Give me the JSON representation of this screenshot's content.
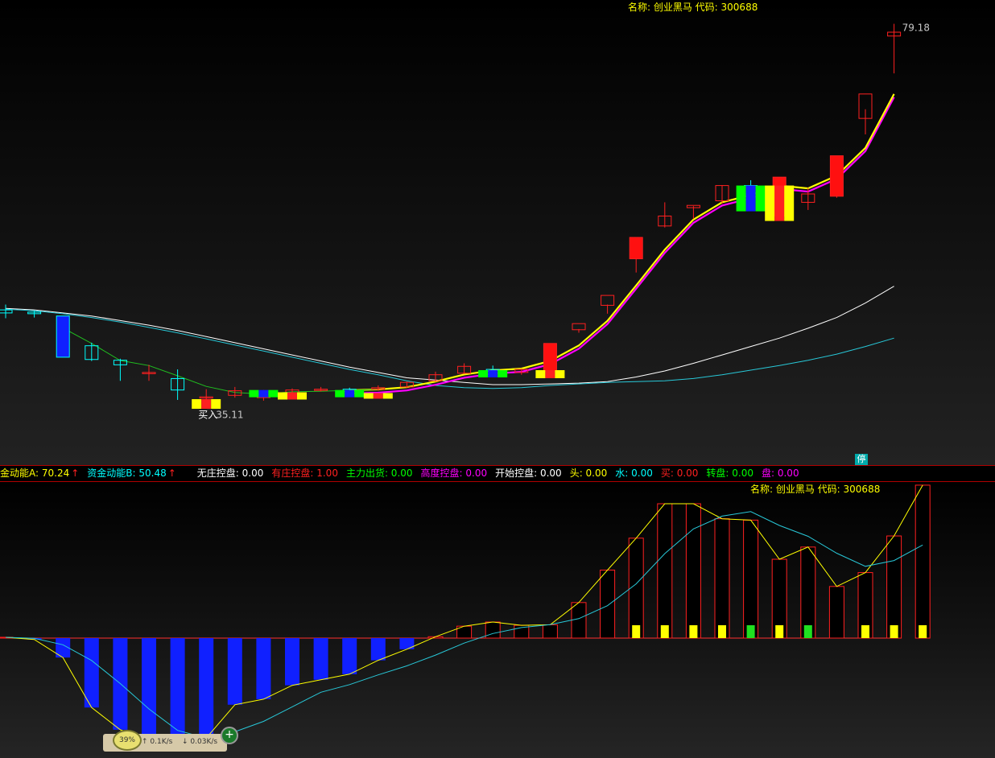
{
  "upper_panel": {
    "title": "名称: 创业黑马 代码: 300688",
    "high_price_label": "79.18",
    "buy_label": "买入",
    "buy_price_label": "35.11",
    "stop_badge": "停"
  },
  "lower_panel": {
    "title": "名称: 创业黑马 代码: 300688"
  },
  "indicator_strip": [
    {
      "label": "金动能A: 70.24",
      "arrow": "↑",
      "color": "#ffff00"
    },
    {
      "label": "资金动能B: 50.48",
      "arrow": "↑",
      "color": "#00ffff"
    },
    {
      "label": "无庄控盘: 0.00",
      "color": "#ffffff"
    },
    {
      "label": "有庄控盘: 1.00",
      "color": "#ff2020"
    },
    {
      "label": "主力出货: 0.00",
      "color": "#00ff00"
    },
    {
      "label": "高度控盘: 0.00",
      "color": "#ff00ff"
    },
    {
      "label": "开始控盘: 0.00",
      "color": "#ffffff"
    },
    {
      "label": "头: 0.00",
      "color": "#ffff00"
    },
    {
      "label": "水: 0.00",
      "color": "#00ffff"
    },
    {
      "label": "买: 0.00",
      "color": "#ff2020"
    },
    {
      "label": "转盘: 0.00",
      "color": "#00ff00"
    },
    {
      "label": "盘: 0.00",
      "color": "#ff00ff"
    }
  ],
  "network_widget": {
    "percent": "39%",
    "up_speed": "0.1K/s",
    "down_speed": "0.03K/s"
  },
  "colors": {
    "up": "#ff2020",
    "down": "#00ffff",
    "ma_fast": "#ffff00",
    "ma_pink": "#ff00ff",
    "ma_white": "#ffffff",
    "ma_cyan": "#28c8d8",
    "ma_green": "#20c020"
  },
  "chart_data": [
    {
      "type": "candlestick",
      "title": "名称: 创业黑马 代码: 300688",
      "candles": [
        {
          "o": 41.7,
          "h": 42.4,
          "l": 40.6,
          "c": 41.3
        },
        {
          "o": 41.4,
          "h": 41.6,
          "l": 40.7,
          "c": 41.2
        },
        {
          "o": 40.9,
          "h": 40.9,
          "l": 35.5,
          "c": 35.5
        },
        {
          "o": 37.0,
          "h": 37.4,
          "l": 35.0,
          "c": 35.2
        },
        {
          "o": 35.1,
          "h": 35.3,
          "l": 32.4,
          "c": 34.5
        },
        {
          "o": 33.5,
          "h": 34.5,
          "l": 32.4,
          "c": 33.5
        },
        {
          "o": 32.7,
          "h": 33.9,
          "l": 29.9,
          "c": 31.2
        },
        {
          "o": 30.3,
          "h": 31.3,
          "l": 29.6,
          "c": 30.3
        },
        {
          "o": 30.5,
          "h": 31.6,
          "l": 30.2,
          "c": 31.1
        },
        {
          "o": 30.2,
          "h": 31.2,
          "l": 29.8,
          "c": 30.6
        },
        {
          "o": 30.8,
          "h": 31.4,
          "l": 30.5,
          "c": 31.2
        },
        {
          "o": 31.3,
          "h": 31.6,
          "l": 31.0,
          "c": 31.3
        },
        {
          "o": 31.3,
          "h": 31.5,
          "l": 30.8,
          "c": 31.0
        },
        {
          "o": 31.3,
          "h": 31.8,
          "l": 31.1,
          "c": 31.5
        },
        {
          "o": 31.6,
          "h": 32.3,
          "l": 31.5,
          "c": 32.2
        },
        {
          "o": 32.4,
          "h": 33.6,
          "l": 32.3,
          "c": 33.2
        },
        {
          "o": 33.4,
          "h": 34.7,
          "l": 33.3,
          "c": 34.3
        },
        {
          "o": 33.9,
          "h": 34.4,
          "l": 33.6,
          "c": 33.8
        },
        {
          "o": 33.5,
          "h": 34.0,
          "l": 33.2,
          "c": 33.9
        },
        {
          "o": 33.6,
          "h": 37.3,
          "l": 33.5,
          "c": 37.3
        },
        {
          "o": 39.1,
          "h": 39.2,
          "l": 38.7,
          "c": 39.9
        },
        {
          "o": 42.3,
          "h": 42.4,
          "l": 41.2,
          "c": 43.6
        },
        {
          "o": 48.4,
          "h": 48.8,
          "l": 46.6,
          "c": 51.2
        },
        {
          "o": 52.7,
          "h": 55.8,
          "l": 52.5,
          "c": 54.0
        },
        {
          "o": 55.1,
          "h": 55.3,
          "l": 53.6,
          "c": 55.4
        },
        {
          "o": 56.0,
          "h": 58.0,
          "l": 55.6,
          "c": 58.0
        },
        {
          "o": 58.0,
          "h": 58.7,
          "l": 55.8,
          "c": 56.9
        },
        {
          "o": 54.0,
          "h": 59.1,
          "l": 53.4,
          "c": 59.1
        },
        {
          "o": 55.8,
          "h": 57.7,
          "l": 54.8,
          "c": 56.9
        },
        {
          "o": 56.6,
          "h": 61.9,
          "l": 56.4,
          "c": 61.9
        },
        {
          "o": 66.8,
          "h": 68.0,
          "l": 64.7,
          "c": 70.0
        },
        {
          "o": 77.6,
          "h": 79.2,
          "l": 72.7,
          "c": 78.1
        }
      ],
      "ma_series": [
        {
          "values": [
            41.9,
            41.7,
            41.3,
            40.9,
            40.3,
            39.7,
            39.0,
            38.2,
            37.4,
            36.6,
            35.8,
            35.0,
            34.2,
            33.5,
            32.8,
            32.5,
            32.2,
            31.9,
            31.9,
            32.0,
            32.1,
            32.3,
            32.9,
            33.7,
            34.7,
            35.8,
            36.9,
            38.0,
            39.3,
            40.7,
            42.6,
            44.8
          ]
        },
        {
          "values": [
            41.8,
            41.6,
            41.2,
            40.7,
            40.1,
            39.4,
            38.7,
            37.9,
            37.1,
            36.3,
            35.5,
            34.7,
            33.9,
            33.2,
            32.4,
            31.8,
            31.5,
            31.4,
            31.5,
            31.8,
            32.0,
            32.2,
            32.3,
            32.4,
            32.7,
            33.2,
            33.8,
            34.4,
            35.1,
            35.9,
            36.9,
            38.0
          ]
        }
      ]
    },
    {
      "type": "bar",
      "title": "名称: 创业黑马 代码: 300688",
      "ylim": [
        -40,
        55
      ],
      "values": [
        0.3,
        -0.5,
        -7,
        -25,
        -33,
        -37,
        -38,
        -36,
        -24,
        -22,
        -17,
        -15,
        -13,
        -8,
        -4,
        0.5,
        4.3,
        5.8,
        4.6,
        4.8,
        12.8,
        24.5,
        36.0,
        48.4,
        48.4,
        43.0,
        42.5,
        28.4,
        32.8,
        18.6,
        23.6,
        36.8,
        55.1
      ]
    }
  ]
}
